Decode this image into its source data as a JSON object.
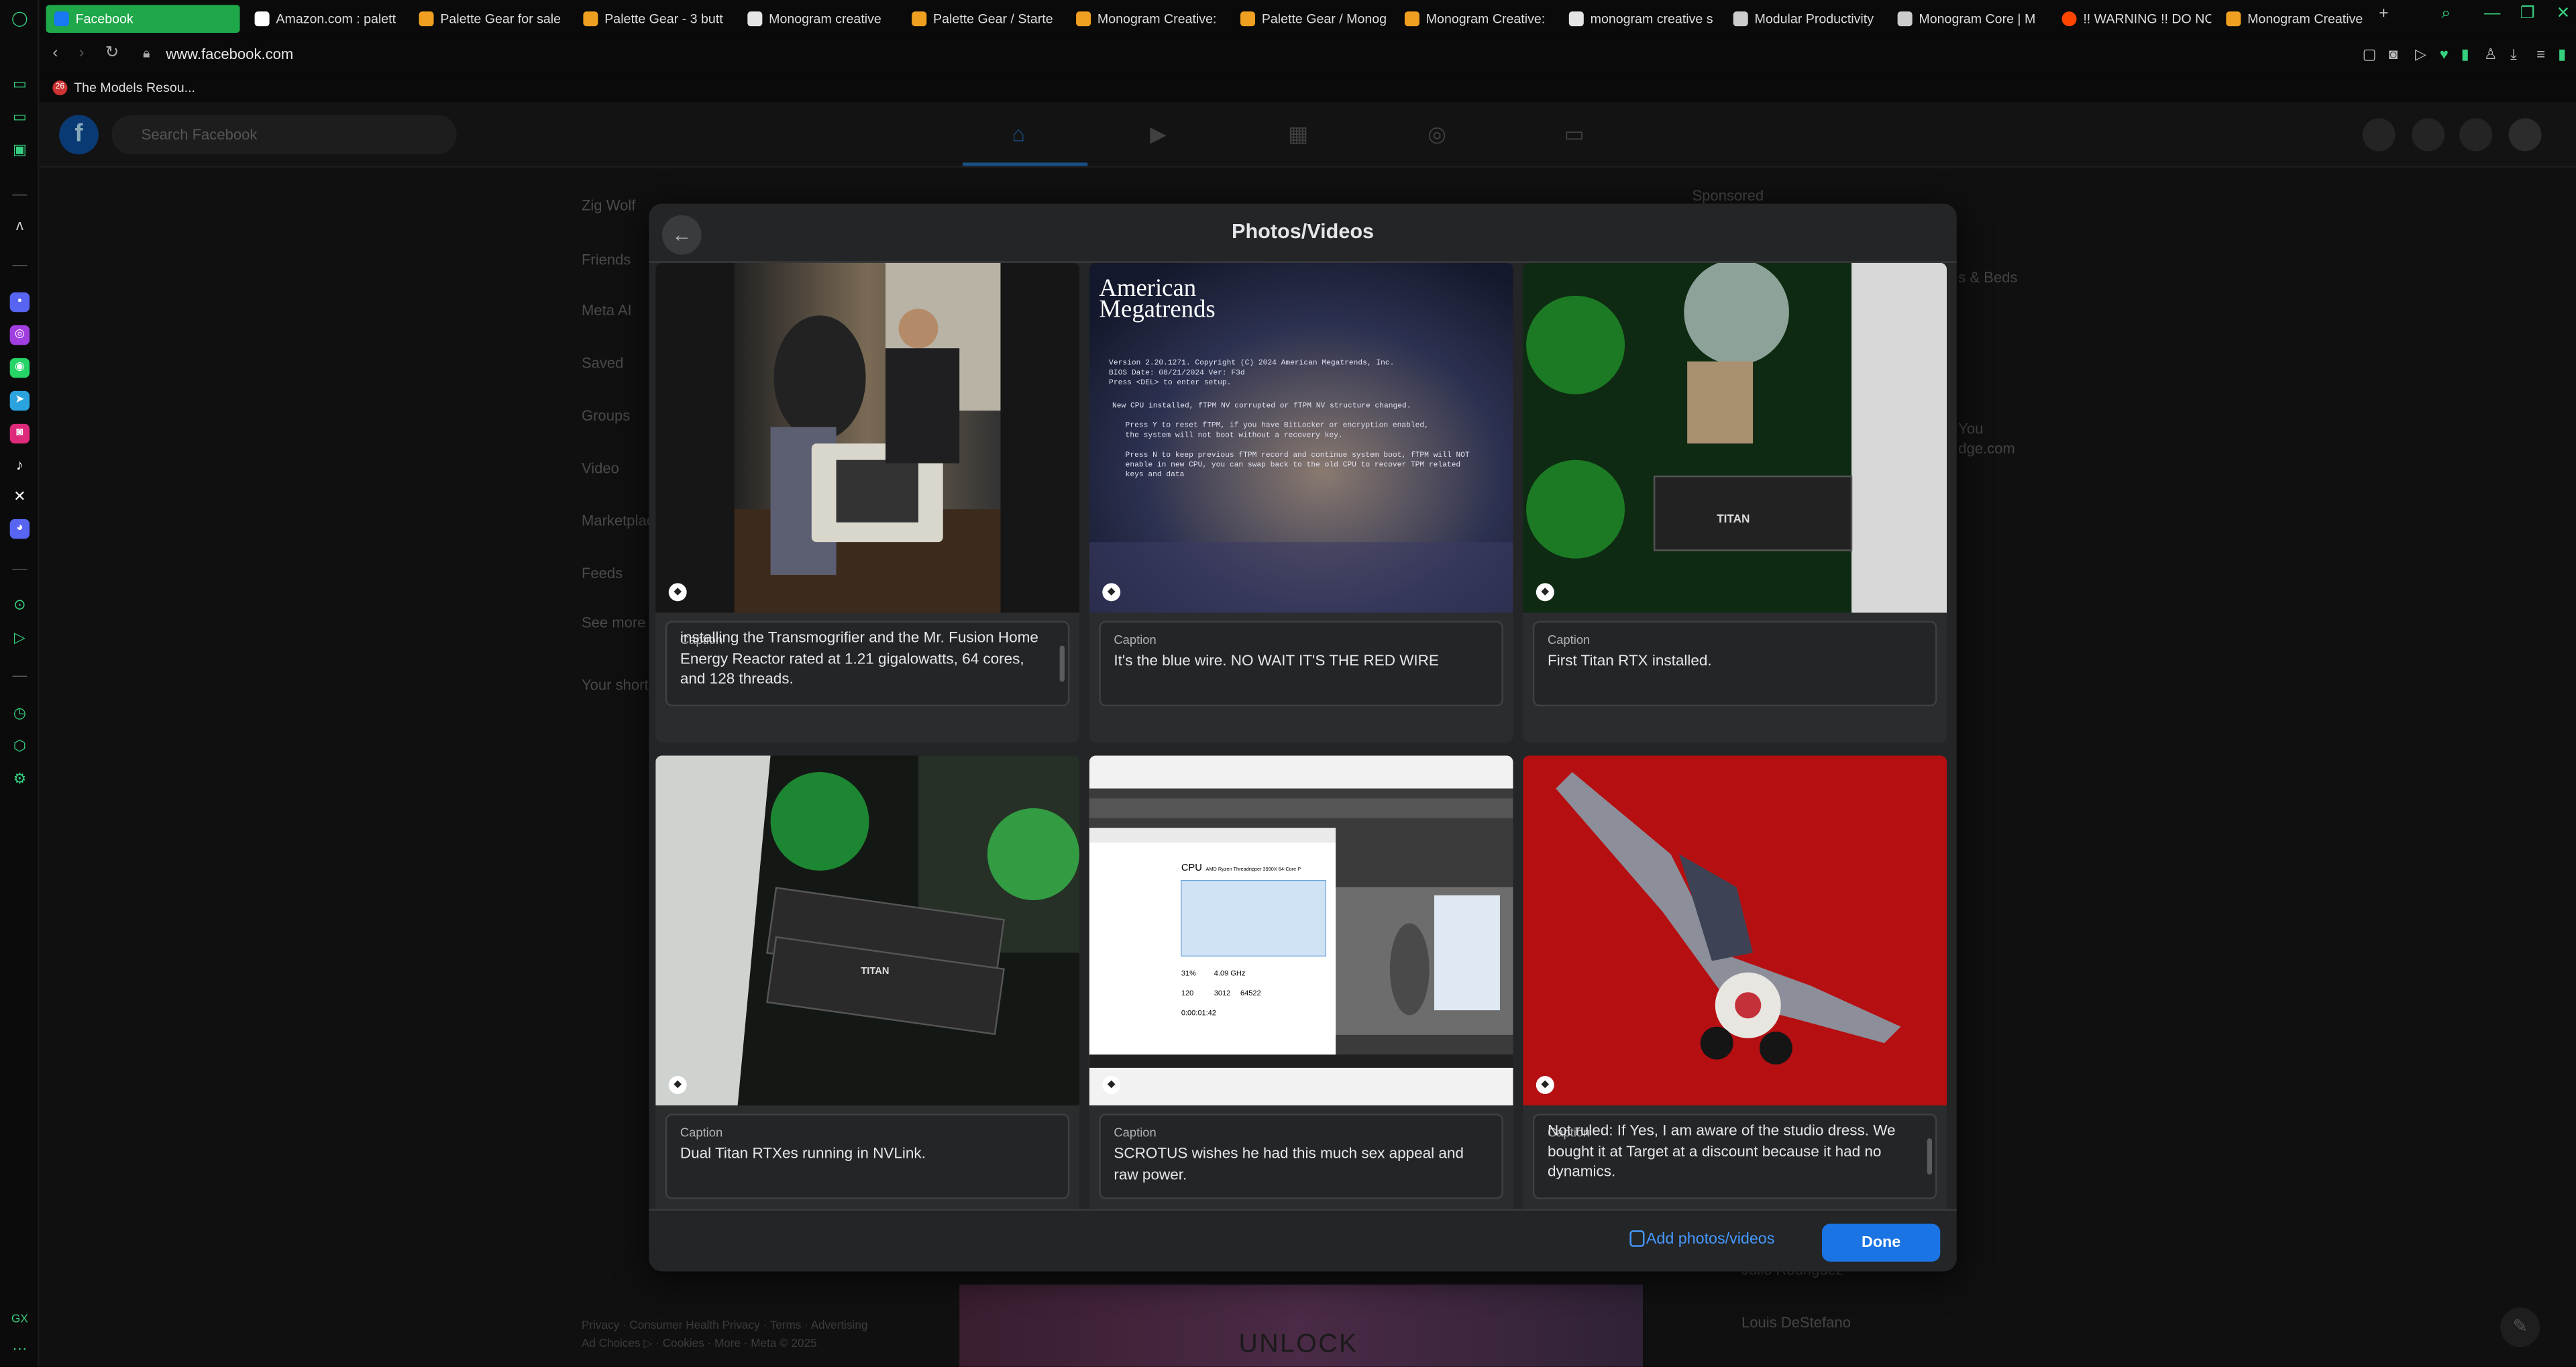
{
  "browser": {
    "tabs": [
      {
        "label": "Facebook",
        "color": "#1877f2",
        "active": true
      },
      {
        "label": "Amazon.com : palett",
        "color": "#ffffff"
      },
      {
        "label": "Palette Gear for sale",
        "color": "#f0a020"
      },
      {
        "label": "Palette Gear - 3 butt",
        "color": "#f0a020"
      },
      {
        "label": "Monogram creative",
        "color": "#e5e5e5"
      },
      {
        "label": "Palette Gear / Starte",
        "color": "#f0a020"
      },
      {
        "label": "Monogram Creative:",
        "color": "#f0a020"
      },
      {
        "label": "Palette Gear / Monog",
        "color": "#f0a020"
      },
      {
        "label": "Monogram Creative:",
        "color": "#f0a020"
      },
      {
        "label": "monogram creative s",
        "color": "#e5e5e5"
      },
      {
        "label": "Modular Productivity",
        "color": "#cccccc"
      },
      {
        "label": "Monogram Core | M",
        "color": "#cccccc"
      },
      {
        "label": "!! WARNING !! DO NC",
        "color": "#ff4500"
      },
      {
        "label": "Monogram Creative",
        "color": "#f0a020"
      }
    ],
    "new_tab": "+",
    "url": "www.facebook.com",
    "bookmark": {
      "label": "The Models Resou...",
      "icon_text": "26"
    }
  },
  "facebook": {
    "logo": "f",
    "search_placeholder": "Search Facebook",
    "left_items": [
      "Zig Wolf",
      "Friends",
      "Meta AI",
      "Saved",
      "Groups",
      "Video",
      "Marketplace",
      "Feeds",
      "See more"
    ],
    "shortcuts_title": "Your shortcuts",
    "right_texts": [
      "Sponsored",
      "s & Beds",
      "You",
      "dge.com"
    ],
    "right_bottom": [
      "Julio Rodriguez",
      "Louis DeStefano"
    ],
    "footer_line1": "Privacy · Consumer Health Privacy · Terms · Advertising",
    "footer_line2": "Ad Choices ▷ · Cookies · More · Meta © 2025",
    "promo_text": "UNLOCK",
    "sidebar_label": "GX"
  },
  "modal": {
    "title": "Photos/Videos",
    "caption_label": "Caption",
    "captions": [
      "installing the Transmogrifier and the Mr. Fusion Home Energy Reactor rated at 1.21 gigalowatts, 64 cores, and 128 threads.",
      "It's the blue wire. NO WAIT IT'S THE RED WIRE",
      "First Titan RTX installed.",
      "Dual Titan RTXes running in NVLink.",
      "SCROTUS wishes he had this much sex appeal and raw power.",
      "Not ruled: If Yes, I am aware of the studio dress. We bought it at Target at a discount because it had no dynamics."
    ],
    "bios_screen": {
      "brand_line1": "American",
      "brand_line2": "Megatrends",
      "lines": [
        "Version 2.20.1271. Copyright (C) 2024 American Megatrends, Inc.",
        "BIOS Date: 08/21/2024 Ver: F3d",
        "Press <DEL> to enter setup.",
        "New CPU installed, fTPM NV corrupted or fTPM NV structure changed.",
        "Press Y to reset fTPM, if you have BitLocker or encryption enabled,",
        "the system will not boot without a recovery key.",
        "Press N to keep previous fTPM record and continue system boot, fTPM will NOT",
        "enable in new CPU, you can swap back to the old CPU to recover TPM related",
        "keys and data"
      ]
    },
    "gpu_label": "TITAN",
    "task_manager": {
      "cpu": "CPU",
      "model": "AMD Ryzen Threadripper 3990X 64-Core P",
      "utilization": "31%",
      "speed": "4.09 GHz",
      "processes": "120",
      "threads": "3012",
      "handles": "64522",
      "uptime": "0:00:01:42"
    },
    "add_label": "Add photos/videos",
    "done_label": "Done"
  },
  "colors": {
    "accent": "#1b74e4",
    "browser_accent": "#1ea84a",
    "modal_bg": "#242526"
  }
}
